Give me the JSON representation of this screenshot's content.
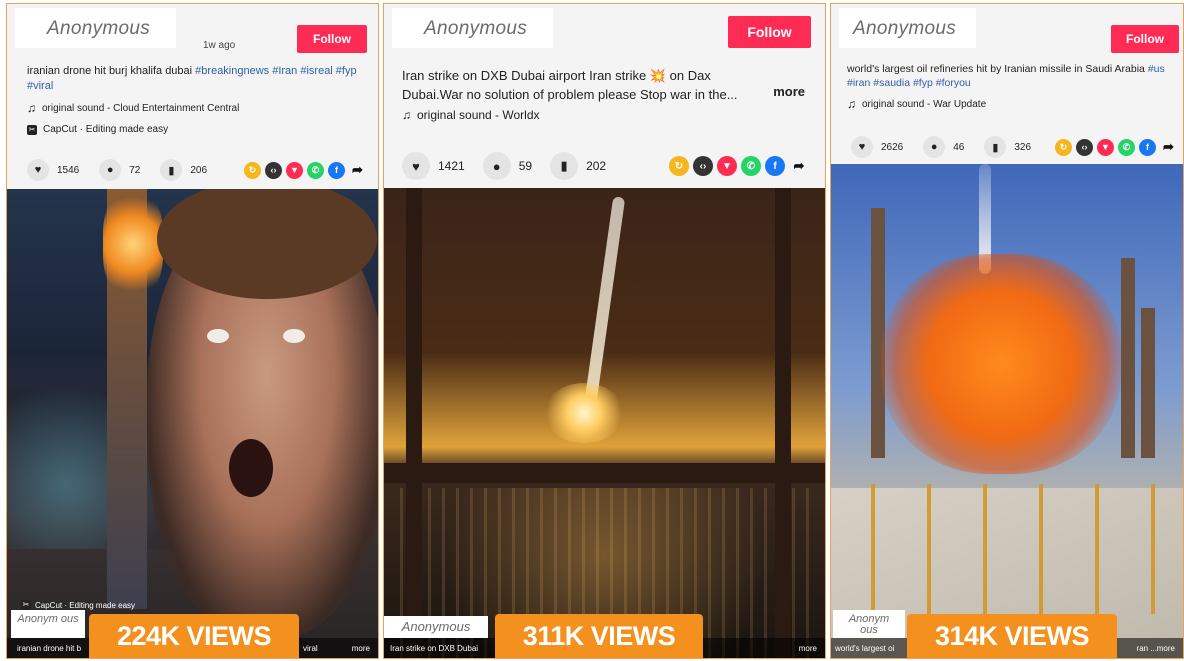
{
  "cards": [
    {
      "author": "Anonymous",
      "time_ago": "1w ago",
      "follow_label": "Follow",
      "caption_text": "iranian drone hit burj khalifa dubai ",
      "caption_tags": "#breakingnews #Iran #isreal #fyp #viral",
      "sound": "original sound - Cloud Entertainment Central",
      "capcut": "CapCut · Editing made easy",
      "likes": "1546",
      "comments": "72",
      "saves": "206",
      "overlay_author": "Anonym ous",
      "overlay_caption": "iranian drone hit b",
      "overlay_caption_end": "viral",
      "overlay_more": "more",
      "overlay_capcut": "CapCut · Editing made easy",
      "views": "224K VIEWS"
    },
    {
      "author": "Anonymous",
      "follow_label": "Follow",
      "caption_text": "Iran strike on DXB Dubai airport Iran strike 💥 on Dax Dubai.War no solution of problem please Stop war in the...",
      "more_label": "more",
      "sound": "original sound - Worldx",
      "likes": "1421",
      "comments": "59",
      "saves": "202",
      "overlay_author": "Anonymous",
      "overlay_caption": "Iran strike on DXB Dubai",
      "overlay_more": "more",
      "views": "311K VIEWS"
    },
    {
      "author": "Anonymous",
      "follow_label": "Follow",
      "caption_text": "world's largest oil refineries hit by Iranian missile in Saudi Arabia ",
      "caption_tags": "#us #iran #saudia #fyp #foryou",
      "sound": "original sound - War Update",
      "likes": "2626",
      "comments": "46",
      "saves": "326",
      "overlay_author": "Anonym ous",
      "overlay_caption": "world's largest oi",
      "overlay_caption_end": "ran ...",
      "overlay_more": "more",
      "views": "314K VIEWS"
    }
  ],
  "share_icons": [
    "repost-icon",
    "embed-icon",
    "send-icon",
    "whatsapp-icon",
    "facebook-icon",
    "share-arrow-icon"
  ],
  "colors": {
    "follow": "#fe2c55",
    "views_badge": "#f4911e",
    "card_border": "#e8a25a",
    "hashtag": "#2e5fa8"
  }
}
